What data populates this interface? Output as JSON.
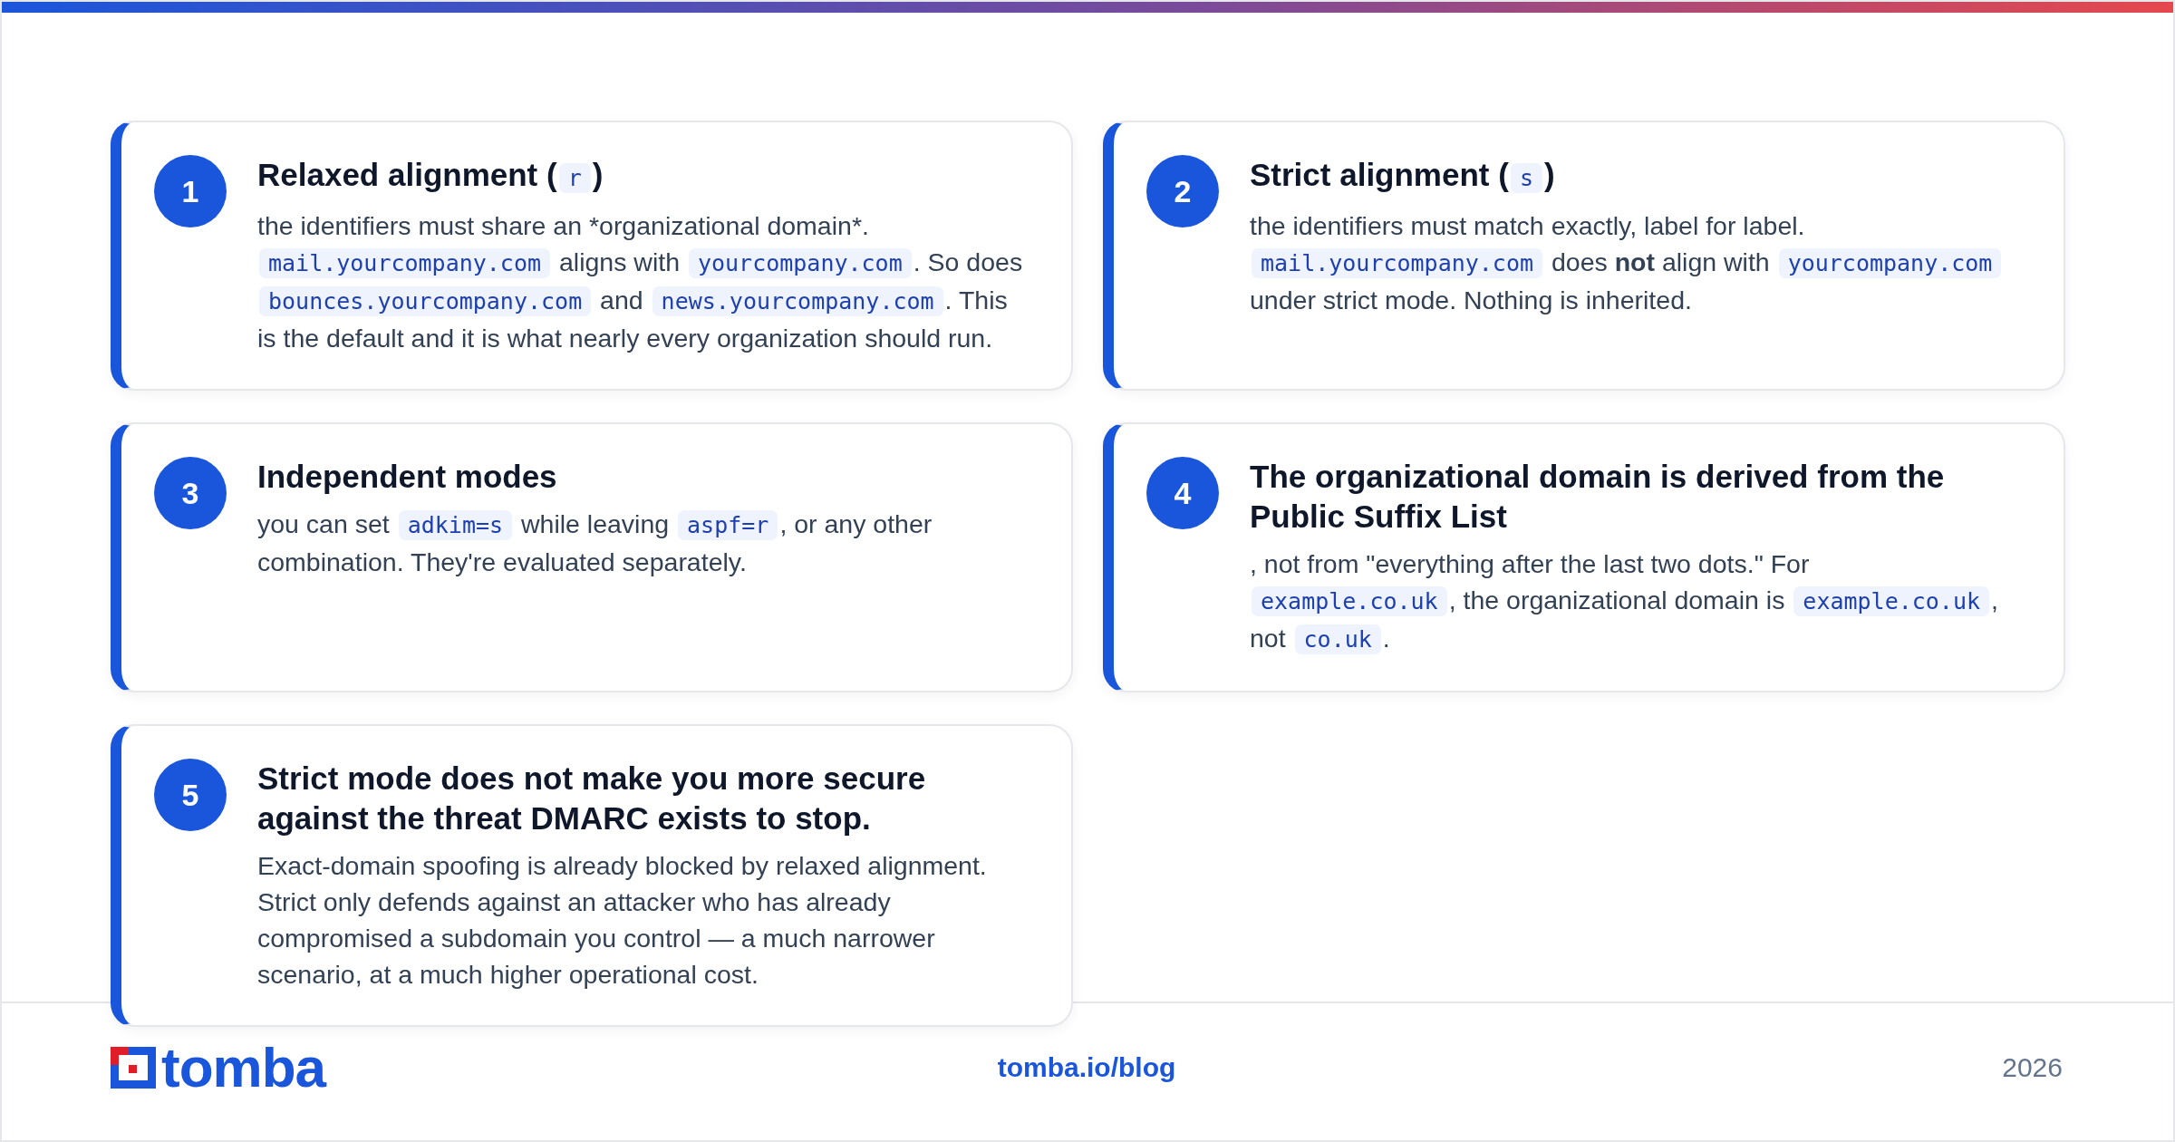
{
  "cards": [
    {
      "number": "1",
      "title": [
        {
          "kind": "text",
          "text": "Relaxed alignment ("
        },
        {
          "kind": "code",
          "text": "r"
        },
        {
          "kind": "text",
          "text": ")"
        }
      ],
      "body": [
        {
          "kind": "text",
          "text": "the identifiers must share an *organizational domain*. "
        },
        {
          "kind": "code",
          "text": "mail.yourcompany.com"
        },
        {
          "kind": "text",
          "text": " aligns with "
        },
        {
          "kind": "code",
          "text": "yourcompany.com"
        },
        {
          "kind": "text",
          "text": ". So does "
        },
        {
          "kind": "code",
          "text": "bounces.yourcompany.com"
        },
        {
          "kind": "text",
          "text": " and "
        },
        {
          "kind": "code",
          "text": "news.yourcompany.com"
        },
        {
          "kind": "text",
          "text": ". This is the default and it is what nearly every organization should run."
        }
      ]
    },
    {
      "number": "2",
      "title": [
        {
          "kind": "text",
          "text": "Strict alignment ("
        },
        {
          "kind": "code",
          "text": "s"
        },
        {
          "kind": "text",
          "text": ")"
        }
      ],
      "body": [
        {
          "kind": "text",
          "text": "the identifiers must match exactly, label for label. "
        },
        {
          "kind": "code",
          "text": "mail.yourcompany.com"
        },
        {
          "kind": "text",
          "text": " does "
        },
        {
          "kind": "bold",
          "text": "not"
        },
        {
          "kind": "text",
          "text": " align with "
        },
        {
          "kind": "code",
          "text": "yourcompany.com"
        },
        {
          "kind": "text",
          "text": " under strict mode. Nothing is inherited."
        }
      ]
    },
    {
      "number": "3",
      "title": [
        {
          "kind": "text",
          "text": "Independent modes"
        }
      ],
      "body": [
        {
          "kind": "text",
          "text": "you can set "
        },
        {
          "kind": "code",
          "text": "adkim=s"
        },
        {
          "kind": "text",
          "text": " while leaving "
        },
        {
          "kind": "code",
          "text": "aspf=r"
        },
        {
          "kind": "text",
          "text": ", or any other combination. They're evaluated separately."
        }
      ]
    },
    {
      "number": "4",
      "title": [
        {
          "kind": "text",
          "text": "The organizational domain is derived from the Public Suffix List"
        }
      ],
      "body": [
        {
          "kind": "text",
          "text": ", not from \"everything after the last two dots.\" For "
        },
        {
          "kind": "code",
          "text": "example.co.uk"
        },
        {
          "kind": "text",
          "text": ", the organizational domain is "
        },
        {
          "kind": "code",
          "text": "example.co.uk"
        },
        {
          "kind": "text",
          "text": ", not "
        },
        {
          "kind": "code",
          "text": "co.uk"
        },
        {
          "kind": "text",
          "text": "."
        }
      ]
    },
    {
      "number": "5",
      "title": [
        {
          "kind": "text",
          "text": "Strict mode does not make you more secure against the threat DMARC exists to stop."
        }
      ],
      "body": [
        {
          "kind": "text",
          "text": "Exact-domain spoofing is already blocked by relaxed alignment. Strict only defends against an attacker who has already compromised a subdomain you control — a much narrower scenario, at a much higher operational cost."
        }
      ]
    }
  ],
  "footer": {
    "logo": "tomba",
    "link": "tomba.io/blog",
    "year": "2026"
  }
}
